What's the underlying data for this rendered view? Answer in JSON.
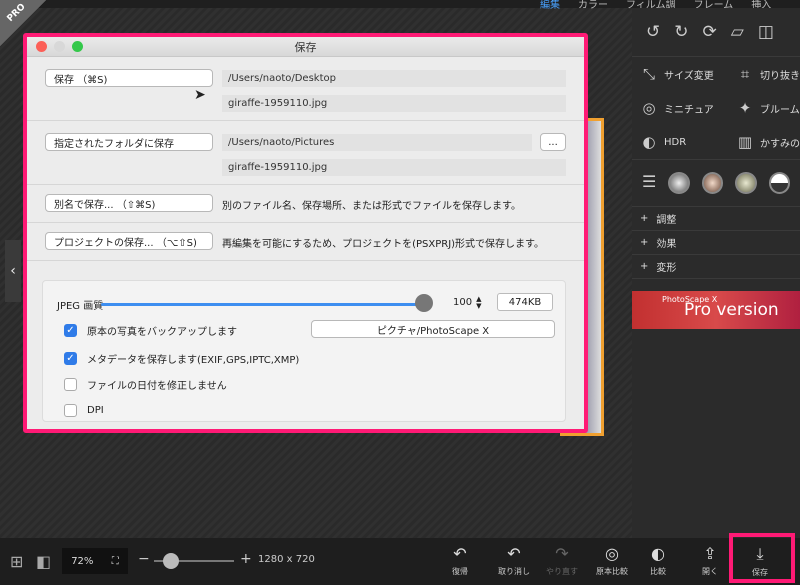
{
  "top_menu": [
    "編集",
    "カラー",
    "フィルム調",
    "フレーム",
    "挿入"
  ],
  "pro_badge": "PRO",
  "dialog": {
    "title": "保存",
    "save_button": "保存 （⌘S)",
    "save_path": "/Users/naoto/Desktop",
    "save_filename": "giraffe-1959110.jpg",
    "folder_button": "指定されたフォルダに保存",
    "folder_path": "/Users/naoto/Pictures",
    "browse_button": "...",
    "folder_filename": "giraffe-1959110.jpg",
    "save_as_button": "別名で保存... （⇧⌘S)",
    "save_as_desc": "別のファイル名、保存場所、または形式でファイルを保存します。",
    "project_button": "プロジェクトの保存... （⌥⇧S)",
    "project_desc": "再編集を可能にするため、プロジェクトを(PSXPRJ)形式で保存します。",
    "jpeg_label": "JPEG 画質",
    "jpeg_quality": "100",
    "jpeg_quality_fraction": 1.0,
    "file_size": "474KB",
    "backup_label": "原本の写真をバックアップします",
    "backup_checked": true,
    "backup_folder_button": "ピクチャ/PhotoScape X",
    "metadata_label": "メタデータを保存します(EXIF,GPS,IPTC,XMP)",
    "metadata_checked": true,
    "keep_date_label": "ファイルの日付を修正しません",
    "keep_date_checked": false,
    "dpi_label": "DPI",
    "dpi_checked": false
  },
  "right_panel": {
    "tools": [
      {
        "icon": "resize-icon",
        "label": "サイズ変更"
      },
      {
        "icon": "crop-icon",
        "label": "切り抜き"
      },
      {
        "icon": "miniature-icon",
        "label": "ミニチュア"
      },
      {
        "icon": "bloom-icon",
        "label": "ブルーム"
      },
      {
        "icon": "hdr-icon",
        "label": "HDR"
      },
      {
        "icon": "haze-icon",
        "label": "かすみの"
      }
    ],
    "sections": [
      "調整",
      "効果",
      "変形"
    ],
    "banner_small": "PhotoScape X",
    "banner": "Pro version"
  },
  "bottom_bar": {
    "zoom": "72%",
    "dimensions": "1280 x 720",
    "zoom_fraction": 0.17,
    "undo": "復帰",
    "cancel": "取り消し",
    "redo": "やり直す",
    "compare_original": "原本比較",
    "compare": "比較",
    "open": "開く",
    "save": "保存"
  }
}
